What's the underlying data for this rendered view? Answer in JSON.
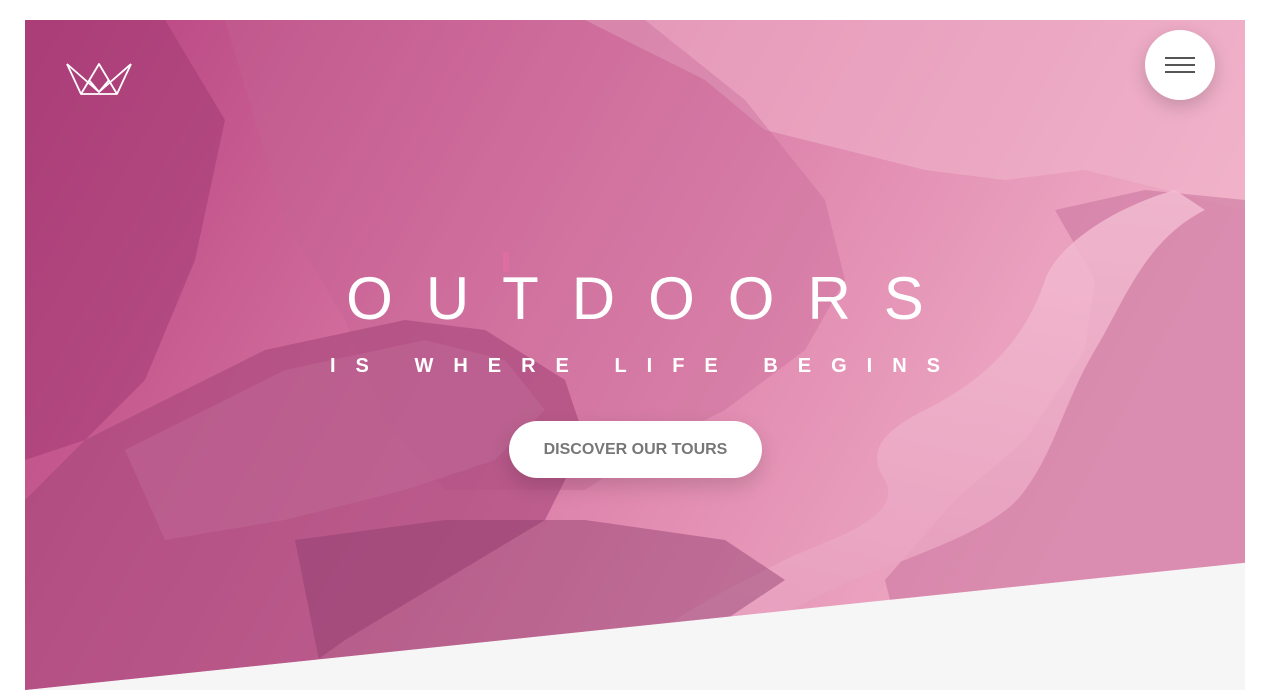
{
  "brand": {
    "logo_icon": "crown-outline-icon"
  },
  "header": {
    "menu_icon": "hamburger-menu-icon"
  },
  "hero": {
    "title": "OUTDOORS",
    "subtitle": "IS WHERE LIFE BEGINS",
    "cta_label": "DISCOVER OUR TOURS",
    "background": "mountain-fjord-photo-pink-overlay"
  },
  "colors": {
    "overlay_dark": "#b43d7a",
    "overlay_light": "#f2a6c2",
    "button_text": "#777777",
    "section_bottom": "#f6f6f6"
  }
}
